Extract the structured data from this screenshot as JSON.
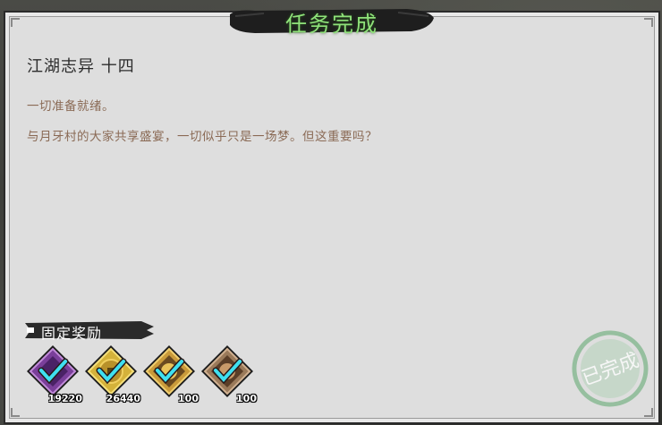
{
  "dialog": {
    "title": "任务完成"
  },
  "quest": {
    "name": "江湖志异 十四",
    "description": [
      "一切准备就绪。",
      "与月牙村的大家共享盛宴，一切似乎只是一场梦。但这重要吗？"
    ]
  },
  "rewards": {
    "section_label": "固定奖励",
    "items": [
      {
        "icon": "purple-exp-icon",
        "quantity": "19220",
        "frame_color": "#7a3f9a",
        "claimed": true
      },
      {
        "icon": "gold-coin-icon",
        "quantity": "26440",
        "frame_color": "#d4b23a",
        "claimed": true
      },
      {
        "icon": "gold-token-icon",
        "quantity": "100",
        "frame_color": "#c99a3a",
        "claimed": true
      },
      {
        "icon": "bronze-token-icon",
        "quantity": "100",
        "frame_color": "#9a7a5a",
        "claimed": true
      }
    ]
  },
  "stamp": {
    "text": "已完成",
    "color": "#7fb58a"
  }
}
